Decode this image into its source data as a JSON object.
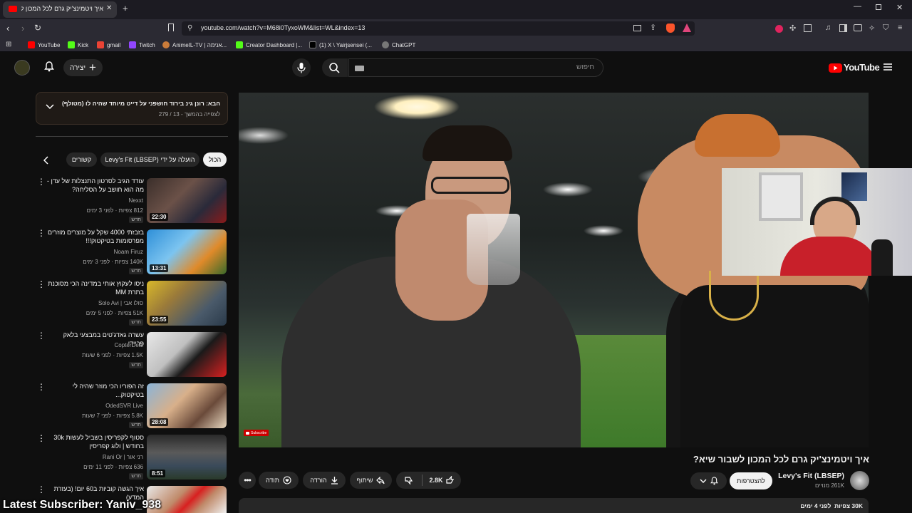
{
  "browser": {
    "tab_title": "איך ויטמינצ'יק גרם לכל המכון לי",
    "url": "youtube.com/watch?v=M68i0TyxoWM&list=WL&index=13",
    "bookmarks": [
      "YouTube",
      "Kick",
      "gmail",
      "Twitch",
      "AnimeIL-TV | אנימה...",
      "Creator Dashboard |...",
      "(1) X \\ Yairjsensei (...",
      "ChatGPT"
    ]
  },
  "header": {
    "logo": "YouTube",
    "search_placeholder": "חיפוש",
    "create_label": "יצירה"
  },
  "playlist": {
    "next_title": "הבא: רונן גינ בירוד חושפני על דייט מיוחד שהיה לו (מטולף)",
    "progress": "לצפייה בהמשך - 13 / 279"
  },
  "chips": [
    "הכול",
    "הועלה על ידי Levy's Fit (LBSEP)",
    "קשורים"
  ],
  "sidebar_videos": [
    {
      "title": "עודד הגיב לסרטון התנצלות של עדן - מה הוא חושב על הסליחה?",
      "channel": "Nexxt",
      "stats": "812 צפיות · לפני 3 ימים",
      "duration": "22:30",
      "badge": "חדש"
    },
    {
      "title": "בזבזתי 4000 שקל על מוצרים מוזרים מפרסומות בטיקטוק!!!",
      "channel": "Noam Firuz",
      "stats": "140K צפיות · לפני 3 ימים",
      "duration": "13:31",
      "badge": "חדש"
    },
    {
      "title": "ניסו לעקוץ אותי במדינה הכי מסוכנת בתרת MM",
      "channel": "סולו אבי | Solo Avi",
      "stats": "51K צפיות · לפני 5 ימים",
      "duration": "23:55",
      "badge": "חדש"
    },
    {
      "title": "עשרה גאדג'טים במבצעי בלאק פריידי",
      "channel": "CopterDeal",
      "stats": "1.5K צפיות · לפני 6 שעות",
      "duration": "",
      "badge": "חדש"
    },
    {
      "title": "זה הפוריו הכי מוזר שהיה לי בטיקטוק...",
      "channel": "OdedSVR Live",
      "stats": "5.8K צפיות · לפני 7 שעות",
      "duration": "28:08",
      "badge": "חדש"
    },
    {
      "title": "סטוף לקפריסין בשביל לעשות 30k בחודש | ולוג קפריסין",
      "channel": "רני אור | Rani Or",
      "stats": "636 צפיות · לפני 11 ימים",
      "duration": "8:51",
      "badge": "חדש"
    },
    {
      "title": "איך הגשה קוביות ב60 יום! (בעזרת המדע)",
      "channel": "",
      "stats": "",
      "duration": "",
      "badge": ""
    }
  ],
  "video": {
    "subscribe_watermark": "Subscribe",
    "title": "איך ויטמינצ'יק גרם לכל המכון לשבור שיא?",
    "channel": "Levy's Fit (LBSEP)",
    "subscribers": "261K מנויים",
    "subscribe_label": "להצטרפות",
    "likes": "2.8K",
    "share_label": "שיתוף",
    "download_label": "הורדה",
    "thanks_label": "תודה",
    "views_line": "30K צפיות  לפני 4 ימים"
  },
  "overlay": {
    "latest_subscriber": "Latest Subscriber: Yaniv_938"
  },
  "colors": {
    "brand_red": "#ff0000",
    "background": "#0f0f0f",
    "chip_bg": "#272727"
  }
}
